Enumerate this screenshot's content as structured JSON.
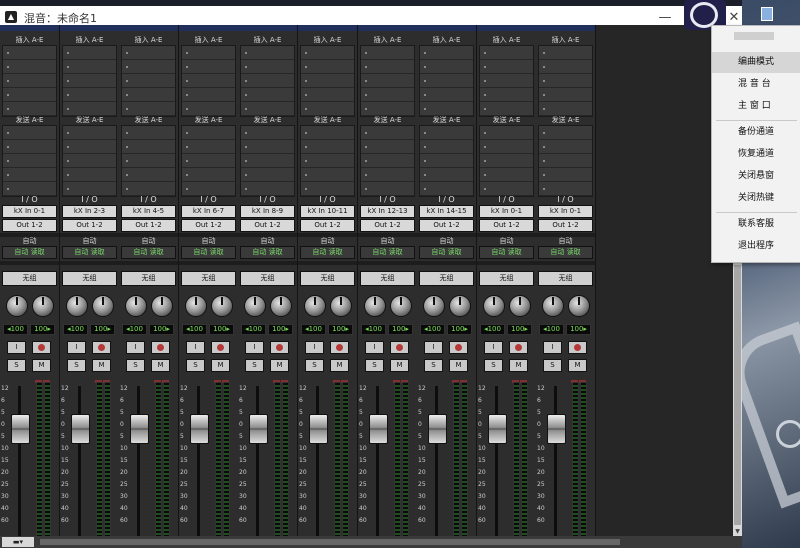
{
  "window": {
    "title": "混音：未命名1",
    "minimize_glyph": "—",
    "maximize_glyph": "☐",
    "close_glyph": "✕"
  },
  "strip_labels": {
    "inserts": "插入 A-E",
    "sends": "发送 A-E",
    "io": "I / O",
    "automation": "自动",
    "auto_mode": "自动 读取",
    "group": "无组",
    "input_monitor": "I",
    "solo": "S",
    "mute": "M"
  },
  "strips": [
    {
      "input": "kX In 0-1",
      "output": "Out 1-2",
      "pan_l": "◂100",
      "pan_r": "100▸"
    },
    {
      "input": "kX In 2-3",
      "output": "Out 1-2",
      "pan_l": "◂100",
      "pan_r": "100▸"
    },
    {
      "input": "kX In 4-5",
      "output": "Out 1-2",
      "pan_l": "◂100",
      "pan_r": "100▸"
    },
    {
      "input": "kX In 6-7",
      "output": "Out 1-2",
      "pan_l": "◂100",
      "pan_r": "100▸"
    },
    {
      "input": "kX In 8-9",
      "output": "Out 1-2",
      "pan_l": "◂100",
      "pan_r": "100▸"
    },
    {
      "input": "kX In 10-11",
      "output": "Out 1-2",
      "pan_l": "◂100",
      "pan_r": "100▸"
    },
    {
      "input": "kX In 12-13",
      "output": "Out 1-2",
      "pan_l": "◂100",
      "pan_r": "100▸"
    },
    {
      "input": "kX In 14-15",
      "output": "Out 1-2",
      "pan_l": "◂100",
      "pan_r": "100▸"
    },
    {
      "input": "kX In 0-1",
      "output": "Out 1-2",
      "pan_l": "◂100",
      "pan_r": "100▸"
    },
    {
      "input": "kX In 0-1",
      "output": "Out 1-2",
      "pan_l": "◂100",
      "pan_r": "100▸"
    }
  ],
  "fader_scale": [
    "12",
    "6",
    "5",
    "0",
    "5",
    "10",
    "15",
    "20",
    "25",
    "30",
    "40",
    "60"
  ],
  "context_menu": {
    "items": [
      "编曲模式",
      "混 音 台",
      "主 窗 口",
      "备份通道",
      "恢复通道",
      "关闭悬窗",
      "关闭热键",
      "联系客服",
      "退出程序"
    ],
    "highlighted": "编曲模式"
  },
  "hscroll": {
    "left_control": "▬▾"
  },
  "colors": {
    "strip_bg": "#2d2d2d",
    "strip_header": "#20305a",
    "pan_green": "#7de05a",
    "auto_green": "#7ad86b",
    "record_red": "#b53838"
  }
}
